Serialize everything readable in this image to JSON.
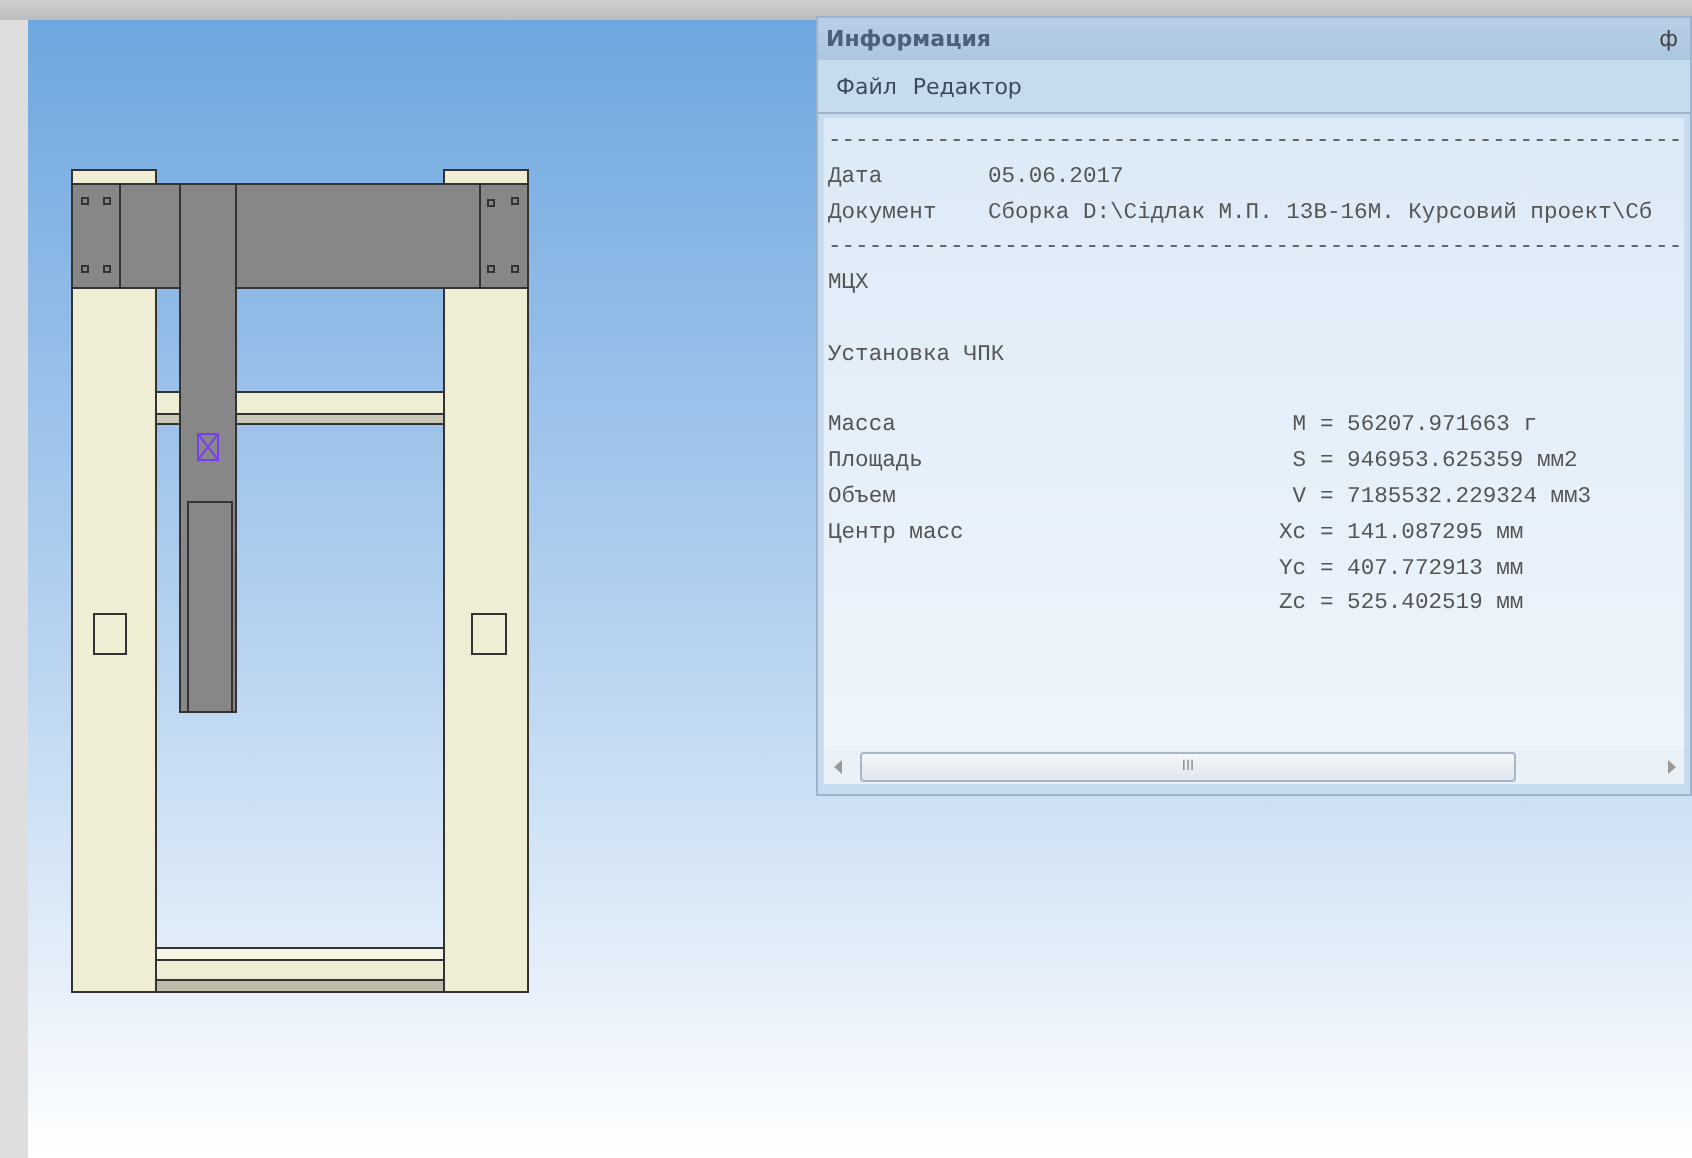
{
  "info_panel": {
    "title": "Информация",
    "pin": "ф",
    "menu": [
      "Файл",
      "Редактор"
    ],
    "lines": [
      {
        "kind": "rule",
        "text": "---------------------------------------------------------------"
      },
      {
        "kind": "field",
        "label": "Дата",
        "value": "05.06.2017"
      },
      {
        "kind": "field",
        "label": "Документ",
        "value": "Сборка D:\\Сідлак М.П. 13В-16М. Курсовий проект\\Сб"
      },
      {
        "kind": "rule",
        "text": "---------------------------------------------------------------"
      },
      {
        "kind": "text",
        "text": "МЦХ"
      },
      {
        "kind": "blank"
      },
      {
        "kind": "text",
        "text": "Установка ЧПК"
      },
      {
        "kind": "blank"
      },
      {
        "kind": "prop",
        "label": "Масса",
        "symbol": "M",
        "value": "= 56207.971663 г"
      },
      {
        "kind": "prop",
        "label": "Площадь",
        "symbol": "S",
        "value": "= 946953.625359 мм2"
      },
      {
        "kind": "prop",
        "label": "Объем",
        "symbol": "V",
        "value": "= 7185532.229324 мм3"
      },
      {
        "kind": "prop",
        "label": "Центр масс",
        "symbol": "Xc",
        "value": "= 141.087295 мм"
      },
      {
        "kind": "prop",
        "symbol": "Yc",
        "value": "= 407.772913 мм"
      },
      {
        "kind": "prop",
        "symbol": "Zc",
        "value": "= 525.402519 мм"
      }
    ],
    "scrollbar_grip": "III"
  }
}
